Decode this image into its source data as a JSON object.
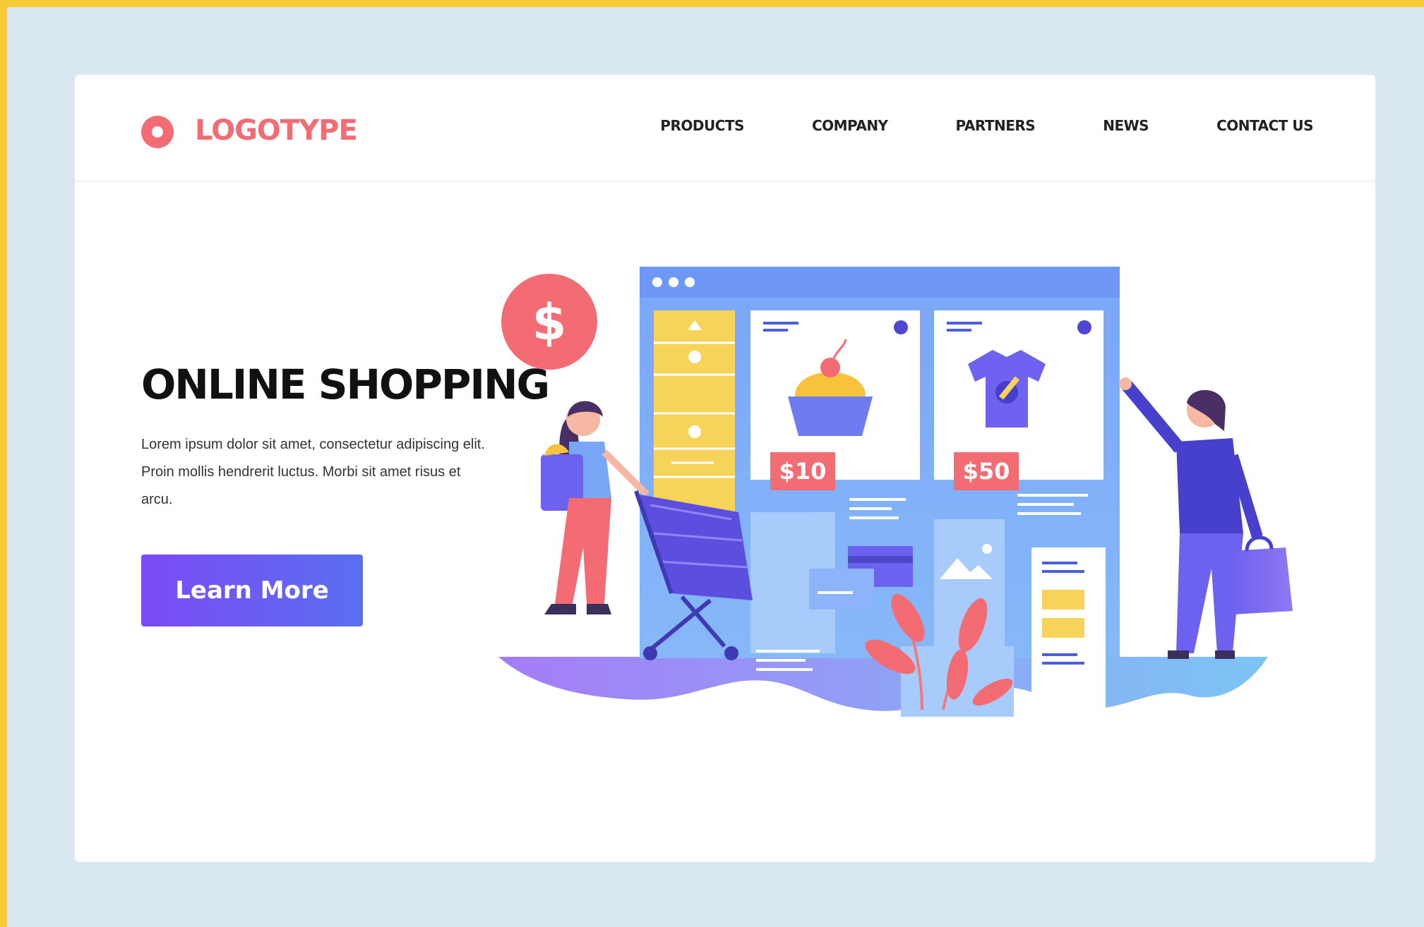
{
  "brand": {
    "name": "LOGOTYPE",
    "accent": "#f36b73"
  },
  "nav": {
    "items": [
      "PRODUCTS",
      "COMPANY",
      "PARTNERS",
      "NEWS",
      "CONTACT US"
    ]
  },
  "hero": {
    "title": "ONLINE SHOPPING",
    "body": "Lorem ipsum dolor sit amet, consectetur adipiscing elit. Proin mollis hendrerit luctus. Morbi sit amet risus et arcu.",
    "cta": "Learn More"
  },
  "illustration": {
    "coin_symbol": "$",
    "price_1": "$10",
    "price_2": "$50"
  },
  "colors": {
    "background": "#d8e7f0",
    "frame": "#f6c935",
    "button": "#6a5cf3",
    "browser": "#7aa6f7"
  }
}
